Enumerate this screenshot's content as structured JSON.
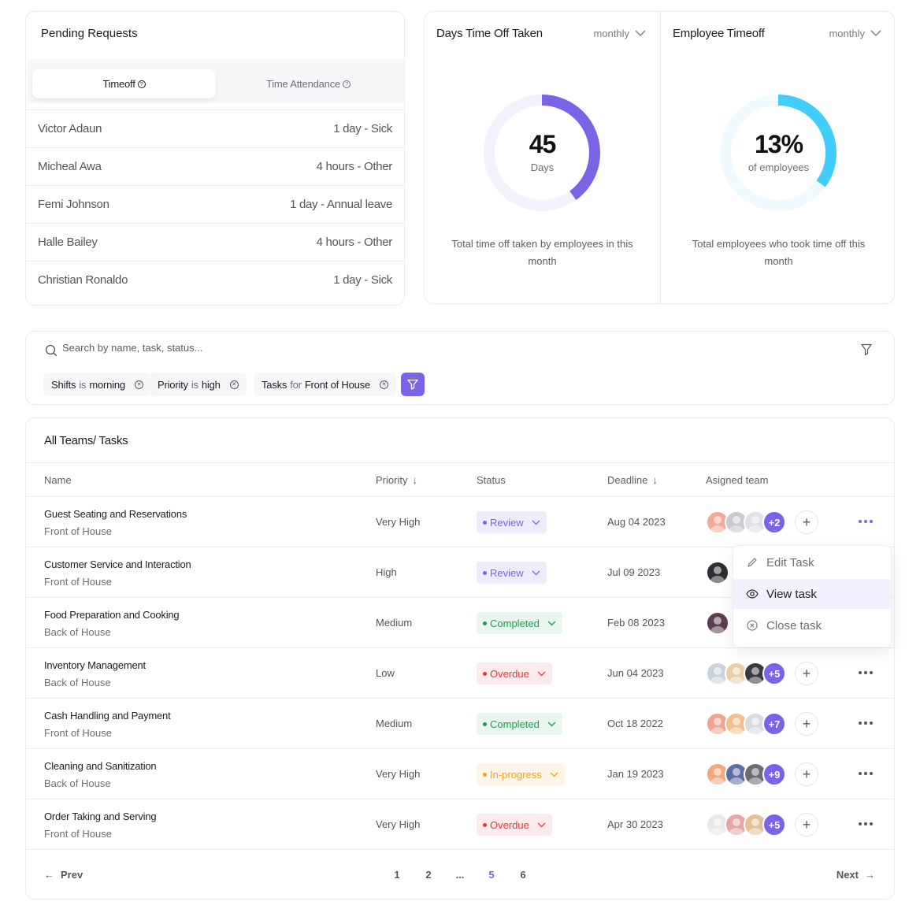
{
  "pending": {
    "title": "Pending Requests",
    "tabs": [
      {
        "label": "Timeoff",
        "active": true
      },
      {
        "label": "Time Attendance",
        "active": false
      }
    ],
    "requests": [
      {
        "name": "Victor Adaun",
        "detail": "1 day - Sick"
      },
      {
        "name": "Micheal Awa",
        "detail": "4 hours - Other"
      },
      {
        "name": "Femi Johnson",
        "detail": "1 day - Annual leave"
      },
      {
        "name": "Halle Bailey",
        "detail": "4 hours - Other"
      },
      {
        "name": "Christian Ronaldo",
        "detail": "1 day - Sick"
      }
    ]
  },
  "stats": [
    {
      "title": "Days Time Off Taken",
      "period": "monthly",
      "value": "45",
      "unit": "Days",
      "fraction": 0.4,
      "color": "#7b63e8",
      "track": "#f4f2fc",
      "description": "Total time off taken by employees in this month"
    },
    {
      "title": "Employee Timeoff",
      "period": "monthly",
      "value": "13%",
      "unit": "of employees",
      "fraction": 0.35,
      "color": "#42cdfb",
      "track": "#f1fbff",
      "description": "Total employees who took time off this month"
    }
  ],
  "filter": {
    "placeholder": "Search by name, task, status...",
    "chips": [
      {
        "field": "Shifts",
        "op": "is",
        "value": "morning"
      },
      {
        "field": "Priority",
        "op": "is",
        "value": "high"
      },
      {
        "field": "Tasks",
        "op": "for",
        "value": "Front of House"
      }
    ]
  },
  "tasks": {
    "title": "All Teams/ Tasks",
    "columns": {
      "name": "Name",
      "priority": "Priority",
      "status": "Status",
      "deadline": "Deadline",
      "team": "Asigned team"
    },
    "rows": [
      {
        "name": "Guest Seating and Reservations",
        "dept": "Front of House",
        "priority": "Very High",
        "status": "Review",
        "deadline": "Aug 04 2023",
        "extra": "+2"
      },
      {
        "name": "Customer Service and Interaction",
        "dept": "Front of House",
        "priority": "High",
        "status": "Review",
        "deadline": "Jul 09 2023",
        "extra": ""
      },
      {
        "name": "Food Preparation and Cooking",
        "dept": "Back of House",
        "priority": "Medium",
        "status": "Completed",
        "deadline": "Feb 08 2023",
        "extra": ""
      },
      {
        "name": "Inventory Management",
        "dept": "Back of House",
        "priority": "Low",
        "status": "Overdue",
        "deadline": "Jun 04 2023",
        "extra": "+5"
      },
      {
        "name": "Cash Handling and Payment",
        "dept": "Front of House",
        "priority": "Medium",
        "status": "Completed",
        "deadline": "Oct 18 2022",
        "extra": "+7"
      },
      {
        "name": "Cleaning and Sanitization",
        "dept": "Back of House",
        "priority": "Very High",
        "status": "In-progress",
        "deadline": "Jan 19 2023",
        "extra": "+9"
      },
      {
        "name": "Order Taking and Serving",
        "dept": "Front of House",
        "priority": "Very High",
        "status": "Overdue",
        "deadline": "Apr 30 2023",
        "extra": "+5"
      }
    ],
    "menu": [
      {
        "label": "Edit Task",
        "icon": "pencil-icon"
      },
      {
        "label": "View task",
        "icon": "eye-icon"
      },
      {
        "label": "Close task",
        "icon": "close-circle-icon"
      }
    ],
    "pagination": {
      "prev": "Prev",
      "next": "Next",
      "pages": [
        "1",
        "2",
        "...",
        "5",
        "6"
      ],
      "current": "5"
    }
  }
}
